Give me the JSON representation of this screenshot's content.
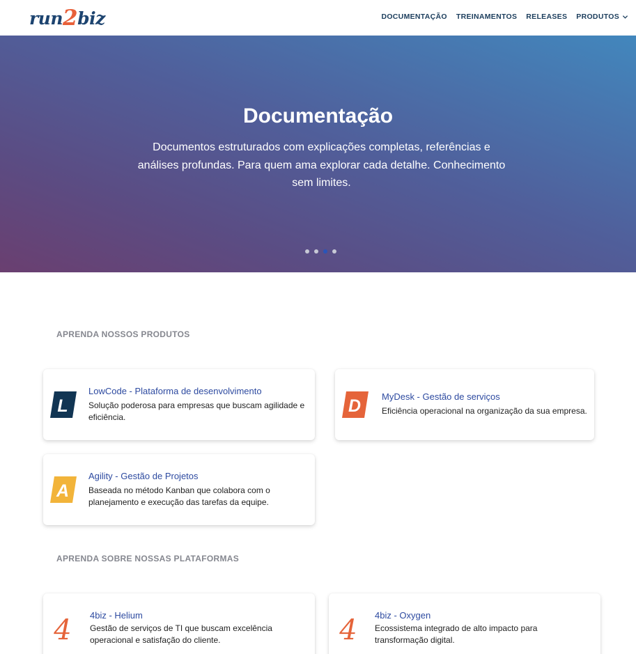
{
  "header": {
    "logo": {
      "part1": "run",
      "part2": "2",
      "part3": "biz"
    },
    "nav": [
      {
        "label": "DOCUMENTAÇÃO"
      },
      {
        "label": "TREINAMENTOS"
      },
      {
        "label": "RELEASES"
      },
      {
        "label": "PRODUTOS"
      }
    ]
  },
  "hero": {
    "title": "Documentação",
    "subtitle": "Documentos estruturados com explicações completas, referências e análises profundas. Para quem ama explorar cada detalhe. Conhecimento sem limites.",
    "slides": 4,
    "active_slide": 3
  },
  "products": {
    "section_title": "APRENDA NOSSOS PRODUTOS",
    "items": [
      {
        "icon": "lowcode-l-icon",
        "letter": "L",
        "color": "#113553",
        "title": "LowCode - Plataforma de desenvolvimento",
        "desc": "Solução poderosa para empresas que buscam agilidade e eficiência."
      },
      {
        "icon": "mydesk-d-icon",
        "letter": "D",
        "color": "#e5643a",
        "title": "MyDesk - Gestão de serviços",
        "desc": "Eficiência operacional na organização da sua empresa."
      },
      {
        "icon": "agility-a-icon",
        "letter": "A",
        "color": "#f2b43a",
        "title": "Agility - Gestão de Projetos",
        "desc": "Baseada no método Kanban que colabora com o planejamento e execução das tarefas da equipe."
      }
    ]
  },
  "platforms": {
    "section_title": "APRENDA SOBRE NOSSAS PLATAFORMAS",
    "items": [
      {
        "icon": "4biz-icon",
        "glyph": "4",
        "color": "#e5643a",
        "title": "4biz - Helium",
        "desc": "Gestão de serviços de TI que buscam excelência operacional e satisfação do cliente."
      },
      {
        "icon": "4biz-icon",
        "glyph": "4",
        "color": "#e5643a",
        "title": "4biz - Oxygen",
        "desc": "Ecossistema integrado de alto impacto para transformação digital."
      }
    ]
  }
}
